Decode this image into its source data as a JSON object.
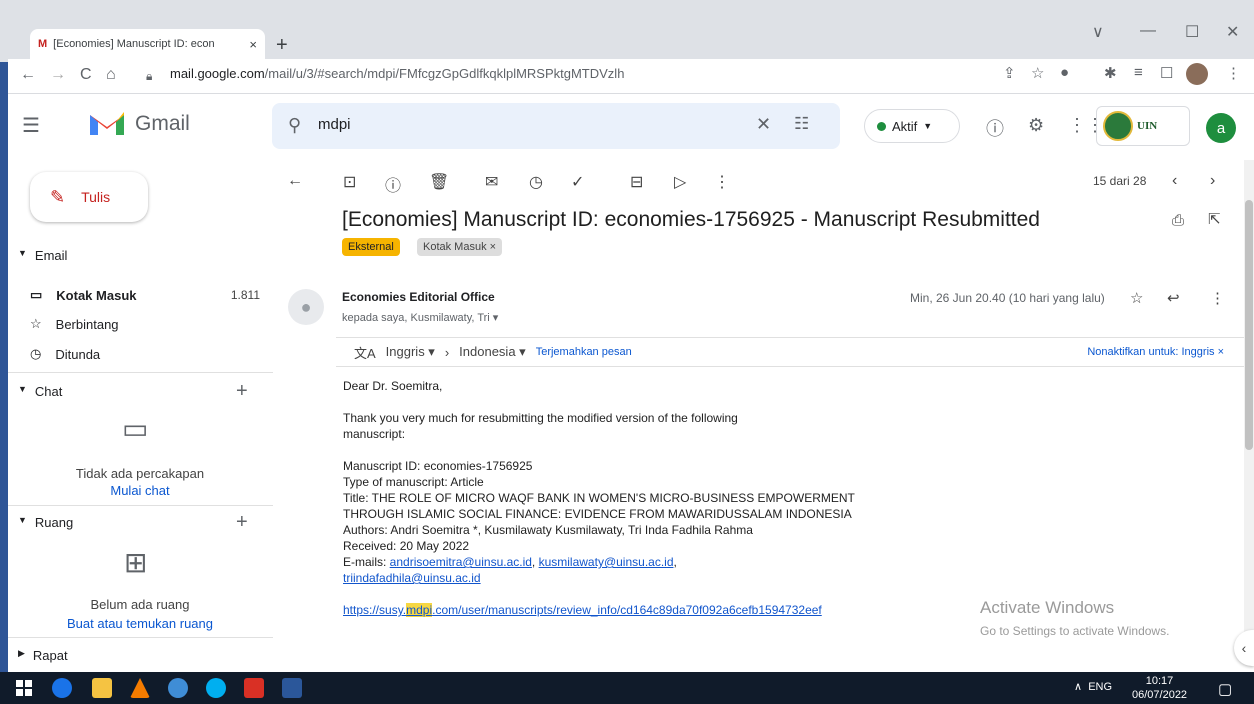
{
  "browser": {
    "tab_title": "[Economies] Manuscript ID: econ",
    "tab_close": "×",
    "new_tab": "+",
    "url_host": "mail.google.com",
    "url_path": "/mail/u/3/#search/mdpi/FMfcgzGpGdlfkqklplMRSPktgMTDVzlh",
    "window_controls": [
      "∨",
      "—",
      "☐",
      "✕"
    ]
  },
  "gmail": {
    "app_name": "Gmail",
    "search_query": "mdpi",
    "status_label": "Aktif",
    "org_logo_text": "UIN",
    "avatar_letter": "a"
  },
  "sidebar": {
    "compose_label": "Tulis",
    "email_section": "Email",
    "items": [
      {
        "label": "Kotak Masuk",
        "count": "1.811",
        "icon": "inbox-icon"
      },
      {
        "label": "Berbintang",
        "count": "",
        "icon": "star-icon"
      },
      {
        "label": "Ditunda",
        "count": "",
        "icon": "clock-icon"
      }
    ],
    "chat_section": "Chat",
    "chat_empty": "Tidak ada percakapan",
    "chat_link": "Mulai chat",
    "rooms_section": "Ruang",
    "rooms_empty": "Belum ada ruang",
    "rooms_link": "Buat atau temukan ruang",
    "meet_section": "Rapat"
  },
  "toolbar": {
    "pager": "15 dari 28"
  },
  "message": {
    "subject": "[Economies] Manuscript ID: economies-1756925 - Manuscript Resubmitted",
    "labels": [
      "Eksternal",
      "Kotak Masuk ×"
    ],
    "sender": "Economies Editorial Office",
    "recipients": "kepada saya, Kusmilawaty, Tri ▾",
    "date": "Min, 26 Jun 20.40 (10 hari yang lalu)",
    "translate": {
      "from": "Inggris ▾",
      "to": "Indonesia ▾",
      "action": "Terjemahkan pesan",
      "disable": "Nonaktifkan untuk: Inggris ×"
    },
    "greeting": "Dear Dr. Soemitra,",
    "para1_line1": "Thank you very much for resubmitting the modified version of the following",
    "para1_line2": "manuscript:",
    "manuscript_id": "Manuscript ID: economies-1756925",
    "type": "Type of manuscript: Article",
    "title_line1": "Title: THE ROLE OF MICRO WAQF BANK IN WOMEN'S MICRO-BUSINESS EMPOWERMENT",
    "title_line2": "THROUGH ISLAMIC SOCIAL FINANCE: EVIDENCE FROM MAWARIDUSSALAM INDONESIA",
    "authors": "Authors: Andri Soemitra *, Kusmilawaty Kusmilawaty, Tri Inda Fadhila Rahma",
    "received": "Received: 20 May 2022",
    "emails_prefix": "E-mails: ",
    "email1": "andrisoemitra@uinsu.ac.id",
    "email2": "kusmilawaty@uinsu.ac.id",
    "email3": "triindafadhila@uinsu.ac.id",
    "link_pre": "https://susy.",
    "link_hl": "mdpi",
    "link_post": ".com/user/manuscripts/review_info/cd164c89da70f092a6cefb1594732eef"
  },
  "overlay": {
    "activate_title": "Activate Windows",
    "activate_sub": "Go to Settings to activate Windows."
  },
  "taskbar": {
    "lang": "ENG",
    "time": "10:17",
    "date": "06/07/2022"
  }
}
